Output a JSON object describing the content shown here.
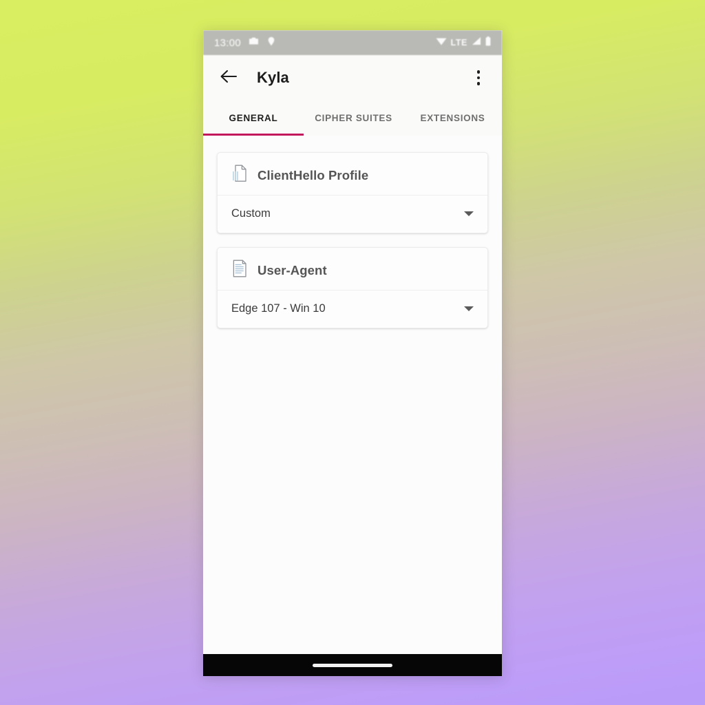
{
  "background": {
    "gradient_from": "#d9ee60",
    "gradient_mid": "#ccbdb8",
    "gradient_to": "#b99bf8"
  },
  "status_bar": {
    "clock": "13:00",
    "background_color": "#b9b9b5",
    "left_icons": [
      {
        "name": "camera-icon"
      },
      {
        "name": "location-pin-icon"
      }
    ],
    "right": {
      "wifi_icon": "wifi-icon",
      "network_label": "LTE",
      "signal_icon": "signal-bars-icon",
      "battery_icon": "battery-icon"
    }
  },
  "app_bar": {
    "back_icon": "back-arrow-icon",
    "title": "Kyla",
    "overflow_icon": "overflow-menu-icon"
  },
  "tabs": {
    "active_index": 0,
    "indicator_color": "#c2185b",
    "items": [
      {
        "label": "GENERAL"
      },
      {
        "label": "CIPHER SUITES"
      },
      {
        "label": "EXTENSIONS"
      }
    ]
  },
  "cards": [
    {
      "icon": "document-shredded-icon",
      "title": "ClientHello Profile",
      "selected_value": "Custom",
      "chevron_icon": "chevron-down-icon"
    },
    {
      "icon": "document-text-icon",
      "title": "User-Agent",
      "selected_value": "Edge 107 - Win 10",
      "chevron_icon": "chevron-down-icon"
    }
  ],
  "nav_bar": {
    "gesture_pill": "gesture-pill-handle",
    "background_color": "#060606"
  }
}
